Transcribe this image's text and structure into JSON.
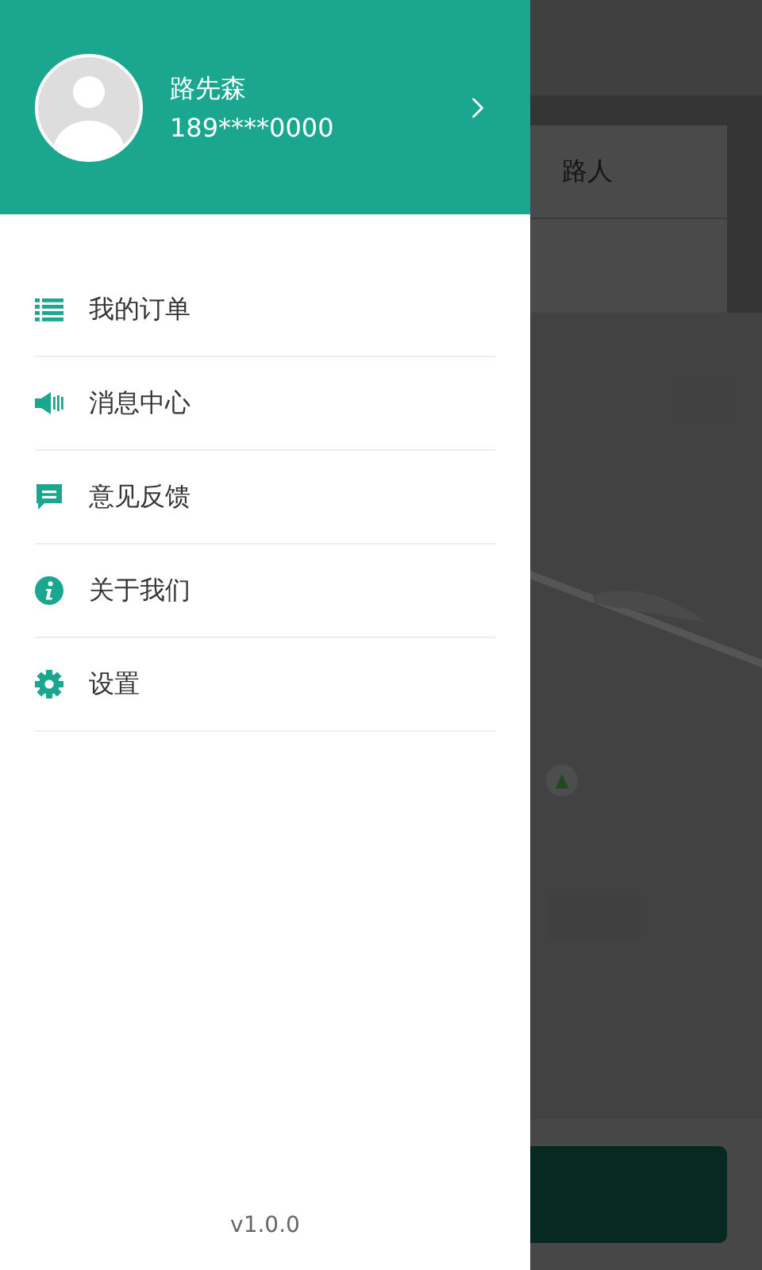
{
  "drawer": {
    "user": {
      "name": "路先森",
      "phone": "189****0000"
    },
    "menu": [
      {
        "label": "我的订单"
      },
      {
        "label": "消息中心"
      },
      {
        "label": "意见反馈"
      },
      {
        "label": "关于我们"
      },
      {
        "label": "设置"
      }
    ],
    "version": "v1.0.0"
  },
  "background": {
    "card_text": "路人"
  }
}
